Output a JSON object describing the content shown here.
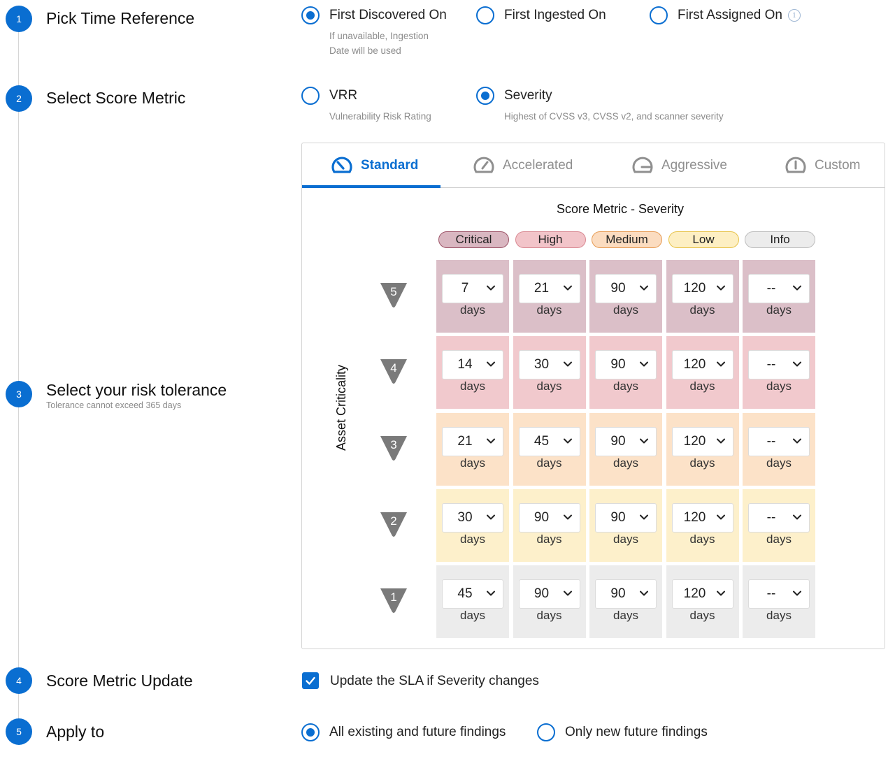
{
  "steps": [
    {
      "num": "1",
      "title": "Pick Time Reference"
    },
    {
      "num": "2",
      "title": "Select Score Metric"
    },
    {
      "num": "3",
      "title": "Select your risk tolerance",
      "subtitle": "Tolerance cannot exceed 365 days"
    },
    {
      "num": "4",
      "title": "Score Metric Update"
    },
    {
      "num": "5",
      "title": "Apply to"
    }
  ],
  "time_reference": {
    "options": [
      {
        "label": "First Discovered On",
        "help": [
          "If unavailable, Ingestion",
          "Date will be used"
        ],
        "selected": true
      },
      {
        "label": "First Ingested On",
        "selected": false
      },
      {
        "label": "First Assigned On",
        "icon": "info-icon",
        "selected": false
      }
    ]
  },
  "score_metric": {
    "options": [
      {
        "label": "VRR",
        "help": "Vulnerability Risk Rating",
        "selected": false
      },
      {
        "label": "Severity",
        "help": "Highest of CVSS v3, CVSS v2, and scanner severity",
        "selected": true
      }
    ]
  },
  "tabs": [
    {
      "label": "Standard",
      "icon": "gauge-standard-icon",
      "active": true
    },
    {
      "label": "Accelerated",
      "icon": "gauge-accelerated-icon",
      "active": false
    },
    {
      "label": "Aggressive",
      "icon": "gauge-aggressive-icon",
      "active": false
    },
    {
      "label": "Custom",
      "icon": "gauge-custom-icon",
      "active": false
    }
  ],
  "matrix": {
    "title": "Score Metric - Severity",
    "axis_label": "Asset Criticality",
    "unit": "days",
    "severities": [
      {
        "label": "Critical",
        "fill": "#d9b7c1",
        "border": "#9e5569"
      },
      {
        "label": "High",
        "fill": "#f2c4c9",
        "border": "#d98a93"
      },
      {
        "label": "Medium",
        "fill": "#fbdcc0",
        "border": "#e79c55"
      },
      {
        "label": "Low",
        "fill": "#fdefc3",
        "border": "#e7c34a"
      },
      {
        "label": "Info",
        "fill": "#ececec",
        "border": "#bdbdbd"
      }
    ],
    "rows": [
      {
        "criticality": "5",
        "bg": "#dbbfc8",
        "values": [
          "7",
          "21",
          "90",
          "120",
          "--"
        ]
      },
      {
        "criticality": "4",
        "bg": "#f1c9cd",
        "values": [
          "14",
          "30",
          "90",
          "120",
          "--"
        ]
      },
      {
        "criticality": "3",
        "bg": "#fce2c8",
        "values": [
          "21",
          "45",
          "90",
          "120",
          "--"
        ]
      },
      {
        "criticality": "2",
        "bg": "#fdf0cb",
        "values": [
          "30",
          "90",
          "90",
          "120",
          "--"
        ]
      },
      {
        "criticality": "1",
        "bg": "#ececec",
        "values": [
          "45",
          "90",
          "90",
          "120",
          "--"
        ]
      }
    ]
  },
  "score_update": {
    "label": "Update the SLA if Severity changes",
    "checked": true
  },
  "apply_to": {
    "options": [
      {
        "label": "All existing and future findings",
        "selected": true
      },
      {
        "label": "Only new future findings",
        "selected": false
      }
    ]
  },
  "colors": {
    "accent": "#0a6ed1",
    "triangle": "#7a7a7a"
  }
}
